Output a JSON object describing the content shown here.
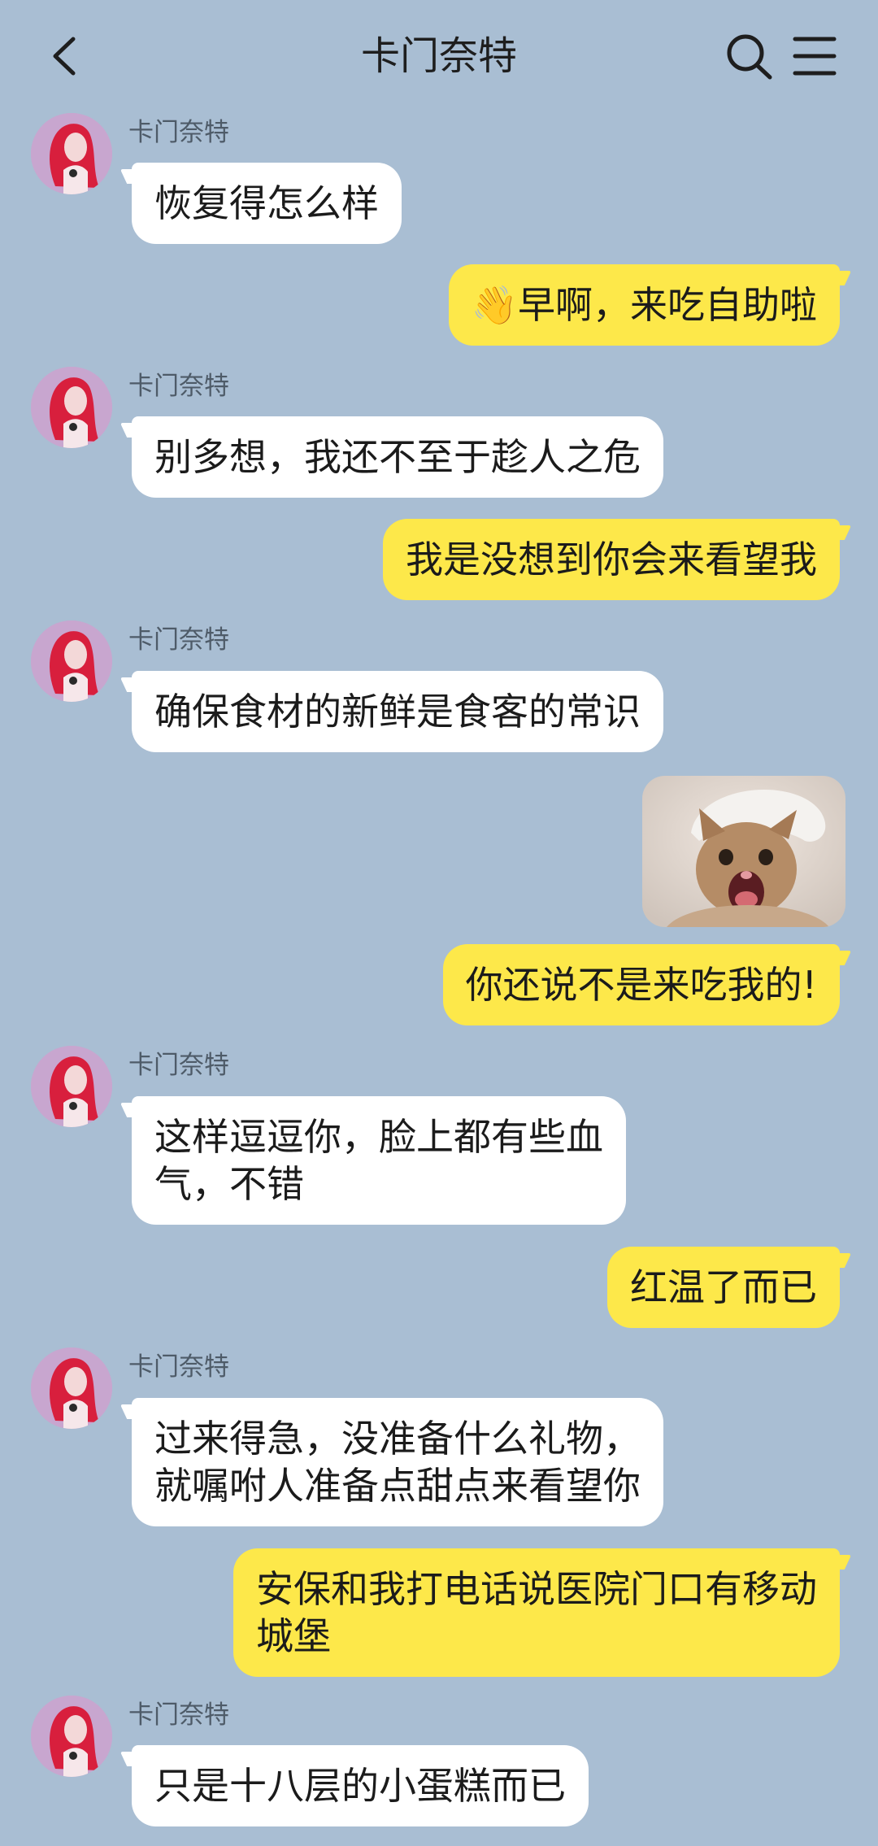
{
  "header": {
    "title": "卡门奈特",
    "back_icon": "chevron-left-icon",
    "search_icon": "search-icon",
    "menu_icon": "hamburger-menu-icon"
  },
  "colors": {
    "background": "#a9bed3",
    "incoming_bubble": "#ffffff",
    "outgoing_bubble": "#fde84a",
    "sender_name": "#4e5b68"
  },
  "messages": [
    {
      "side": "in",
      "sender": "卡门奈特",
      "text": "恢复得怎么样"
    },
    {
      "side": "out",
      "emoji": "👋",
      "text": "早啊，来吃自助啦"
    },
    {
      "side": "in",
      "sender": "卡门奈特",
      "text": "别多想，我还不至于趁人之危"
    },
    {
      "side": "out",
      "text": "我是没想到你会来看望我"
    },
    {
      "side": "in",
      "sender": "卡门奈特",
      "text": "确保食材的新鲜是食客的常识"
    },
    {
      "side": "out",
      "type": "sticker",
      "sticker": "screaming-kitten-in-chef-hat-sticker"
    },
    {
      "side": "out",
      "text": "你还说不是来吃我的!"
    },
    {
      "side": "in",
      "sender": "卡门奈特",
      "text": "这样逗逗你，脸上都有些血\n气，不错"
    },
    {
      "side": "out",
      "text": "红温了而已"
    },
    {
      "side": "in",
      "sender": "卡门奈特",
      "text": "过来得急，没准备什么礼物，\n就嘱咐人准备点甜点来看望你"
    },
    {
      "side": "out",
      "text": "安保和我打电话说医院门口有移动\n城堡"
    },
    {
      "side": "in",
      "sender": "卡门奈特",
      "text": "只是十八层的小蛋糕而已"
    }
  ]
}
